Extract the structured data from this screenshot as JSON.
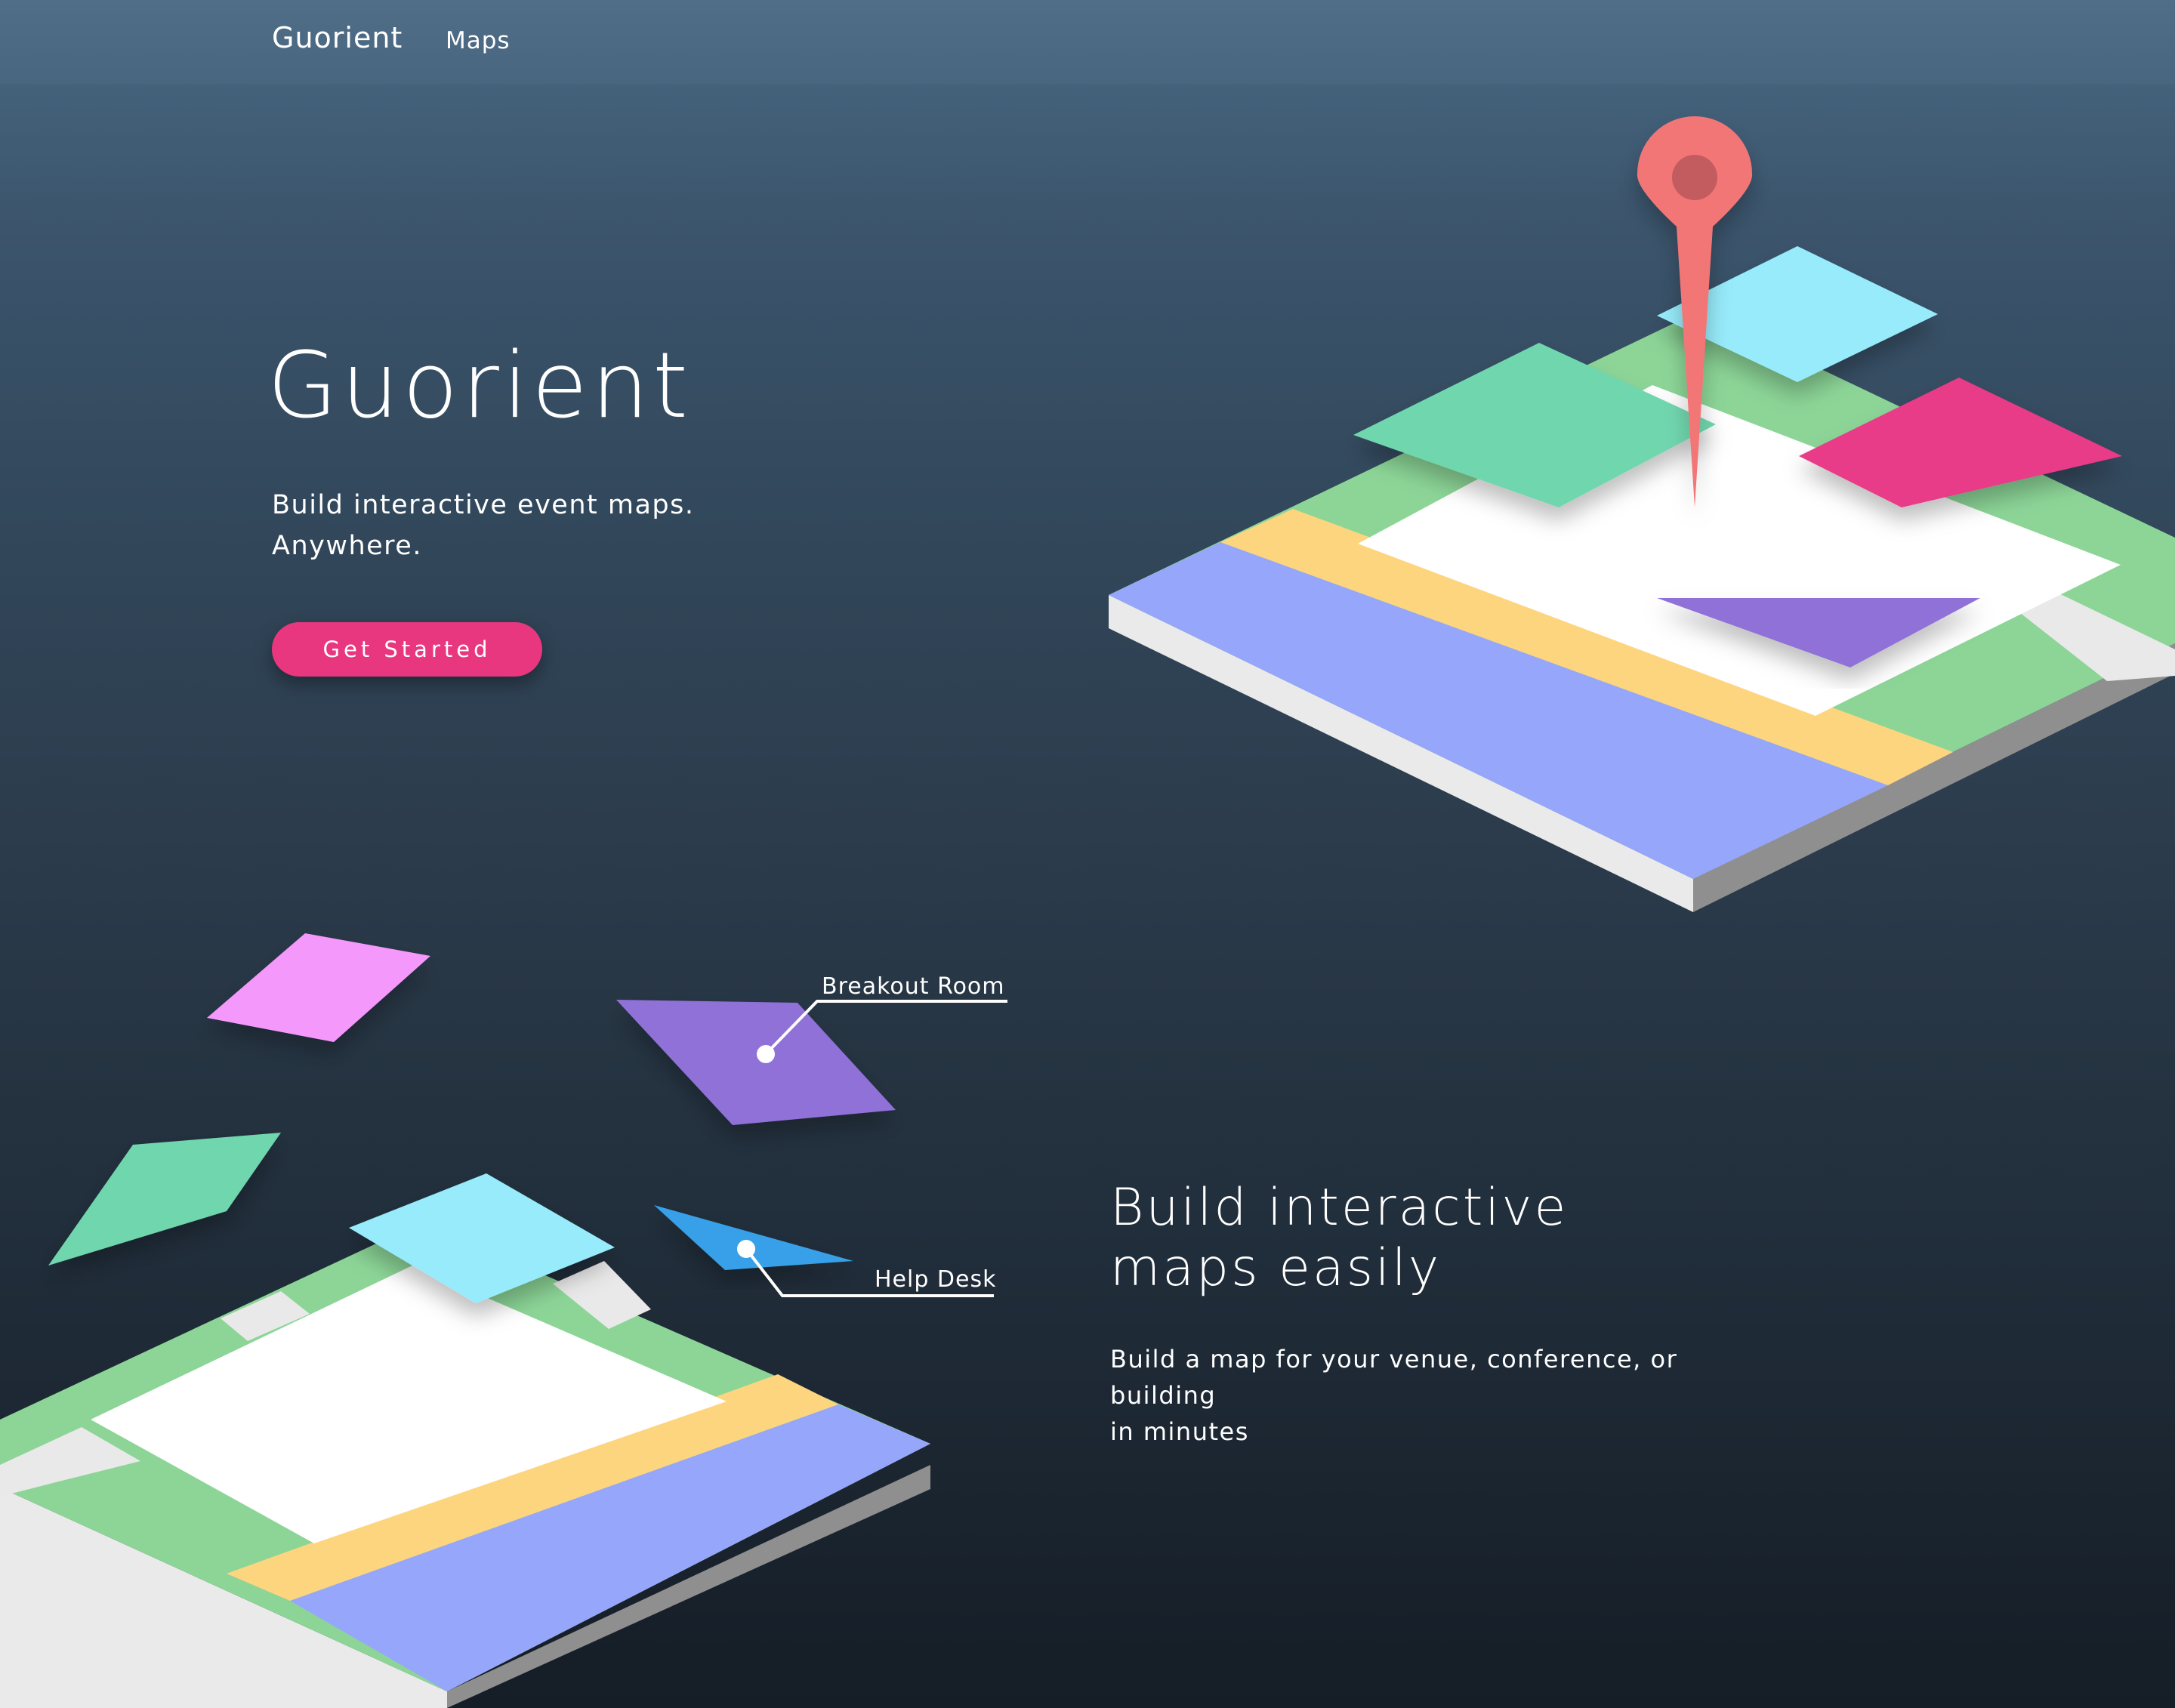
{
  "nav": {
    "brand": "Guorient",
    "links": [
      "Maps"
    ]
  },
  "hero": {
    "title": "Guorient",
    "subtitle_line1": "Build interactive event maps.",
    "subtitle_line2": "Anywhere.",
    "cta_label": "Get Started"
  },
  "features": {
    "title_line1": "Build interactive",
    "title_line2": "maps easily",
    "text_line1": "Build a map for your venue, conference, or building",
    "text_line2": "in minutes"
  },
  "illustration": {
    "labels": [
      "Breakout Room",
      "Help Desk"
    ],
    "icons": [
      "map-pin-icon"
    ]
  },
  "colors": {
    "accent": "#e8377f",
    "pin": "#f37676",
    "green": "#6fd6ae",
    "cyan": "#97ebfb",
    "purple": "#9071d7",
    "blue": "#38a0e8",
    "pink": "#f598fb",
    "road_yellow": "#fdd57f",
    "road_blue": "#96a6fb"
  }
}
